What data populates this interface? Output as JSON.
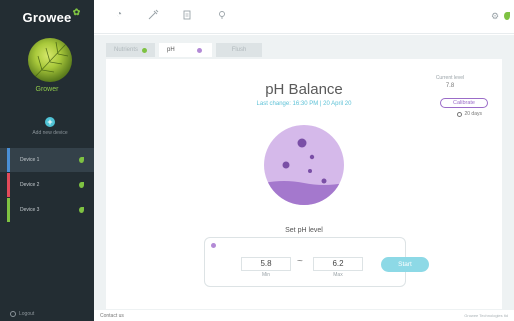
{
  "app": {
    "logo": "Growee"
  },
  "sidebar": {
    "user_name": "Grower",
    "add_device_label": "Add new device",
    "devices": [
      {
        "label": "Device 1",
        "color": "#4a8fd6",
        "active": true
      },
      {
        "label": "Device 2",
        "color": "#e24a5a",
        "active": false
      },
      {
        "label": "Device 3",
        "color": "#7ec242",
        "active": false
      }
    ],
    "logout_label": "Logout"
  },
  "topbar": {
    "icons": [
      "dashboard-icon",
      "pipette-icon",
      "clipboard-icon",
      "bulb-icon"
    ],
    "settings_icon": "gear-icon"
  },
  "tabs": [
    {
      "label": "Nutrients",
      "dot_color": "#7ec242",
      "active": false
    },
    {
      "label": "pH",
      "dot_color": "#b38ad6",
      "active": true
    },
    {
      "label": "Flush",
      "dot_color": "",
      "active": false
    }
  ],
  "main": {
    "title": "pH Balance",
    "last_change": "Last change: 16:30 PM | 20 April 20",
    "current_level_label": "Current level",
    "current_level_value": "7.8",
    "calibrate_label": "Calibrate",
    "days_label": "20 days",
    "set_level_label": "Set pH level",
    "min_value": "5.8",
    "min_label": "Min",
    "max_value": "6.2",
    "max_label": "Max",
    "range_separator": "~",
    "start_label": "Start"
  },
  "footer": {
    "contact": "Contact us",
    "copyright": "Growee Technologies ltd"
  },
  "colors": {
    "sidebar_bg": "#232d33",
    "accent_green": "#7ec242",
    "accent_cyan": "#5cc1d6",
    "accent_purple": "#9b6cc8",
    "ph_circle": "#d5b9ea"
  }
}
